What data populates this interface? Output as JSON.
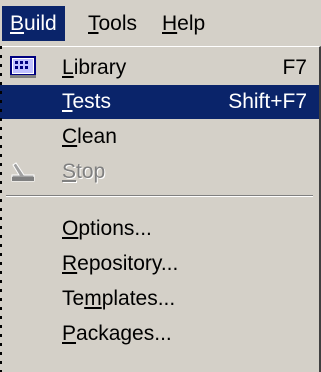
{
  "menubar": {
    "items": [
      {
        "label": "Build",
        "mnemonic_first": "B",
        "rest": "uild"
      },
      {
        "label": "Tools",
        "mnemonic_first": "T",
        "rest": "ools"
      },
      {
        "label": "Help",
        "mnemonic_first": "H",
        "rest": "elp"
      }
    ]
  },
  "dropdown": {
    "library": {
      "m": "L",
      "rest": "ibrary",
      "shortcut": "F7",
      "icon": "library-icon"
    },
    "tests": {
      "m": "T",
      "rest": "ests",
      "shortcut": "Shift+F7"
    },
    "clean": {
      "m": "C",
      "rest": "lean"
    },
    "stop": {
      "m": "S",
      "rest": "top",
      "icon": "stop-icon"
    },
    "options": {
      "m": "O",
      "rest": "ptions..."
    },
    "repository": {
      "m": "R",
      "rest": "epository..."
    },
    "templates": {
      "pre": "Te",
      "m": "m",
      "rest": "plates..."
    },
    "packages": {
      "m": "P",
      "rest": "ackages..."
    }
  },
  "colors": {
    "highlight": "#0a246a",
    "menu_bg": "#d4d0c8",
    "disabled": "#808080"
  }
}
